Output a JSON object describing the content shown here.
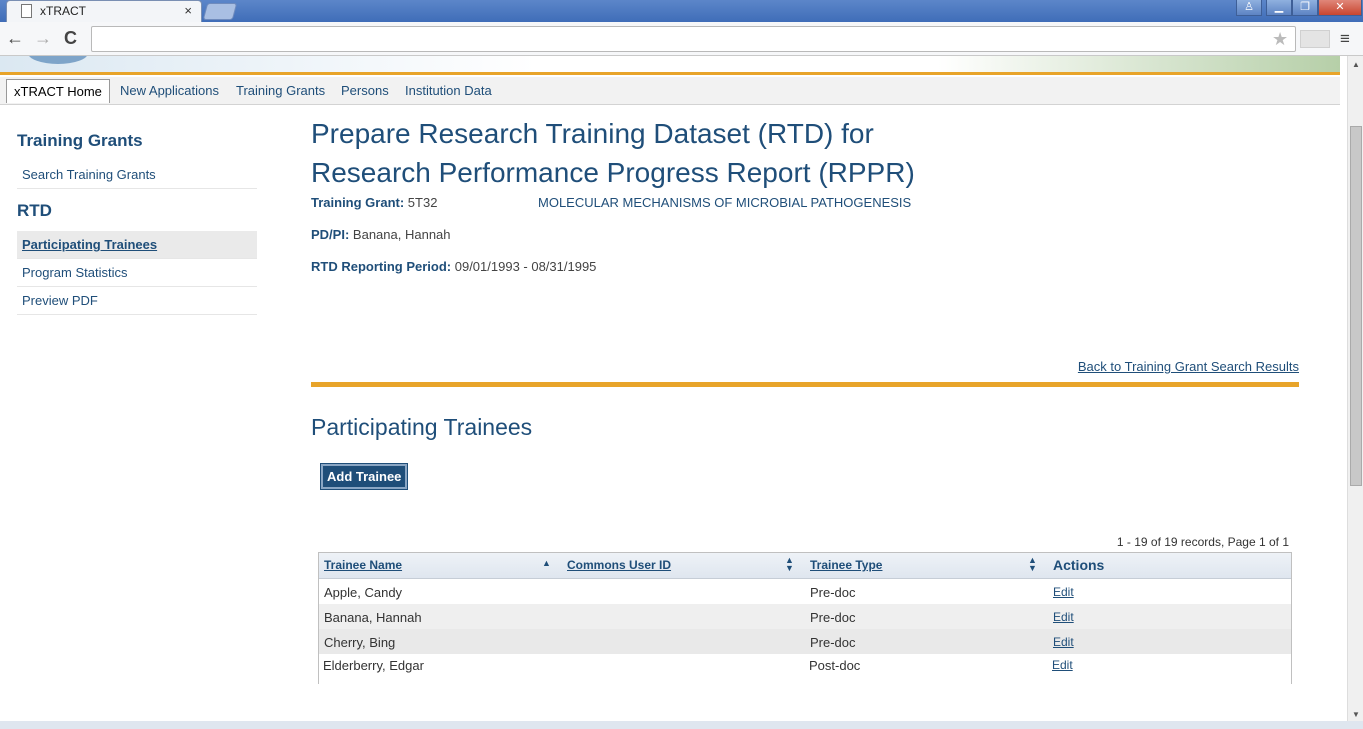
{
  "browser": {
    "tab_title": "xTRACT",
    "tab_close": "×",
    "url": "",
    "back": "←",
    "forward": "→",
    "reload": "C",
    "star": "★",
    "menu": "≡",
    "win_user": "♙",
    "win_min": "▁",
    "win_restore": "❐",
    "win_close": "✕"
  },
  "nav": {
    "items": [
      "xTRACT Home",
      "New Applications",
      "Training Grants",
      "Persons",
      "Institution Data"
    ]
  },
  "sidebar": {
    "heading1": "Training Grants",
    "item1": "Search Training Grants",
    "heading2": "RTD",
    "items": [
      "Participating Trainees",
      "Program Statistics",
      "Preview PDF"
    ]
  },
  "main": {
    "title_line1": "Prepare Research Training Dataset (RTD) for",
    "title_line2": "Research Performance Progress Report (RPPR)",
    "training_grant_label": "Training Grant:",
    "training_grant_value": "5T32",
    "grant_title": "MOLECULAR MECHANISMS OF MICROBIAL PATHOGENESIS",
    "pdpi_label": "PD/PI:",
    "pdpi_value": "Banana, Hannah",
    "period_label": "RTD Reporting Period:",
    "period_value": "09/01/1993 - 08/31/1995",
    "back_link": "Back to Training Grant Search Results",
    "section_title": "Participating Trainees",
    "add_button": "Add Trainee",
    "records_text": "1 - 19 of 19 records, Page 1 of 1"
  },
  "table": {
    "headers": [
      "Trainee Name",
      "Commons User ID",
      "Trainee Type",
      "Actions"
    ],
    "rows": [
      {
        "name": "Apple, Candy",
        "commons_id": "",
        "type": "Pre-doc",
        "action": "Edit"
      },
      {
        "name": "Banana, Hannah",
        "commons_id": "",
        "type": "Pre-doc",
        "action": "Edit"
      },
      {
        "name": "Cherry, Bing",
        "commons_id": "",
        "type": "Pre-doc",
        "action": "Edit"
      },
      {
        "name": "Elderberry, Edgar",
        "commons_id": "",
        "type": "Post-doc",
        "action": "Edit"
      }
    ]
  },
  "colors": {
    "brand_blue": "#1f4e79",
    "accent_orange": "#e8a42a"
  }
}
